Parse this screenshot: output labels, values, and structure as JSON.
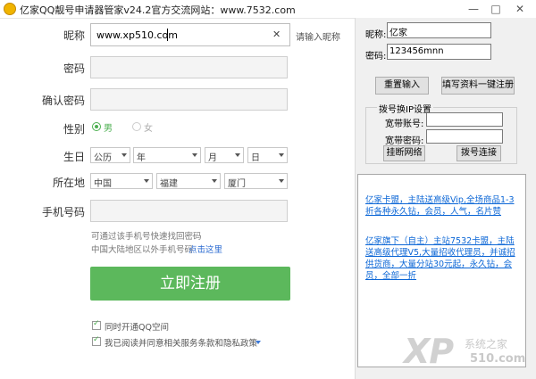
{
  "window": {
    "title": "亿家QQ靓号申请器管家v24.2官方交流网站：www.7532.com",
    "min": "—",
    "max": "□",
    "close": "✕"
  },
  "form": {
    "nickname_label": "昵称",
    "nickname_value": "www.xp510.com",
    "nickname_clear": "✕",
    "nickname_hint": "请输入昵称",
    "password_label": "密码",
    "confirm_label": "确认密码",
    "gender_label": "性别",
    "gender_male": "男",
    "gender_female": "女",
    "birthday_label": "生日",
    "birthday_calendar": "公历",
    "birthday_year": "年",
    "birthday_month": "月",
    "birthday_day": "日",
    "location_label": "所在地",
    "location_country": "中国",
    "location_province": "福建",
    "location_city": "厦门",
    "phone_label": "手机号码",
    "phone_hint1": "可通过该手机号快速找回密码",
    "phone_hint2": "中国大陆地区以外手机号码",
    "phone_hint_link": "点击这里",
    "submit": "立即注册",
    "qzone_check": "同时开通QQ空间",
    "agree_check": "我已阅读并同意相关服务条款和隐私政策"
  },
  "panel": {
    "nick_label": "昵称:",
    "nick_value": "亿家",
    "pwd_label": "密码:",
    "pwd_value": "123456mnn",
    "reset_button": "重置输入",
    "oneclick_button": "填写资料一键注册",
    "dial_group": "拨号换IP设置",
    "account_label": "宽带账号:",
    "bpwd_label": "宽带密码:",
    "hangup_button": "挂断网络",
    "connect_button": "拨号连接",
    "ad1": "亿家卡盟，主陆送高级Vip,全场商品1-3折各种永久钻，会员，人气，名片赞",
    "ad2": "亿家旗下（自主）主站7532卡盟，主陆送高级代理V5,大量招收代理员，并诚招供货商，大量分站30元起，永久钻，会员，全部一折"
  },
  "watermark": {
    "main": "XP",
    "sub": "系统之家",
    "num": "510.com"
  }
}
